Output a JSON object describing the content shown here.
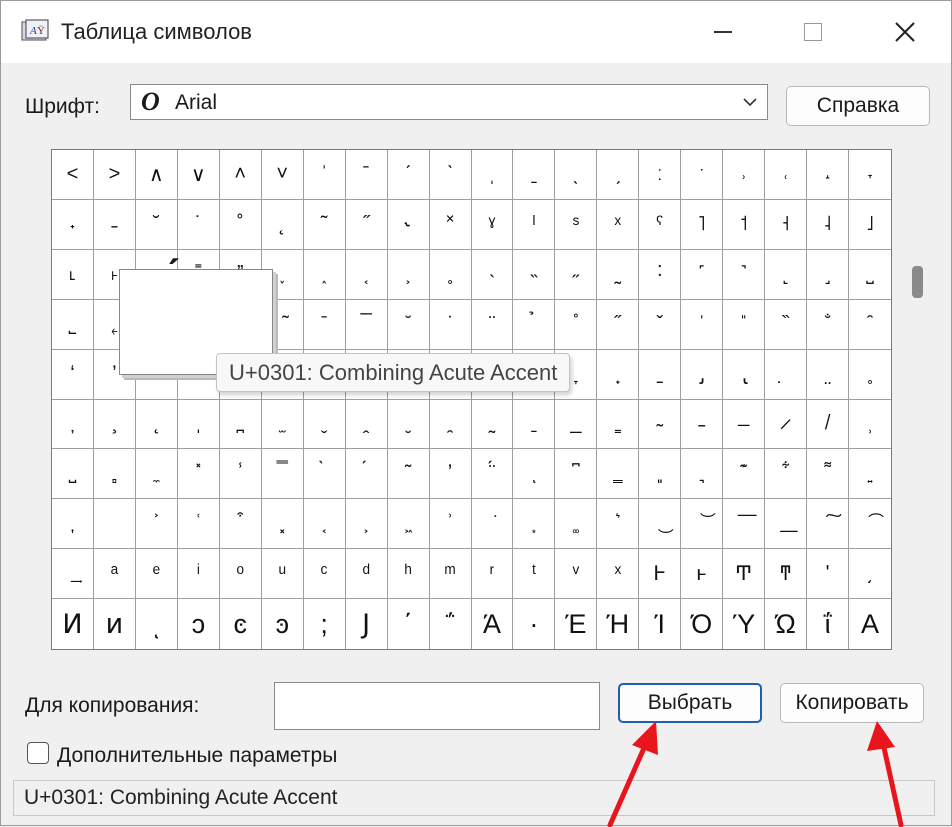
{
  "window": {
    "title": "Таблица символов",
    "controls": {
      "minimize": "minimize",
      "maximize": "maximize",
      "close": "close"
    }
  },
  "font_row": {
    "label": "Шрифт:",
    "logo": "O",
    "selected_font": "Arial",
    "help_button": "Справка"
  },
  "grid": {
    "rows": [
      [
        "<",
        ">",
        "∧",
        "∨",
        "˄",
        "˅",
        "ˈ",
        "ˉ",
        "ˊ",
        "ˋ",
        "ˌ",
        "ˍ",
        "ˎ",
        "ˏ",
        "ː",
        "ˑ",
        "˒",
        "˓",
        "˔",
        "˕"
      ],
      [
        "˖",
        "˗",
        "˘",
        "˙",
        "˚",
        "˛",
        "˜",
        "˝",
        "˞",
        "˟",
        "ˠ",
        "ˡ",
        "ˢ",
        "ˣ",
        "ˤ",
        "˥",
        "˦",
        "˧",
        "˨",
        "˩"
      ],
      [
        "˪",
        "˫",
        "ˬ",
        "˭",
        "ˮ",
        "˯",
        "˰",
        "˱",
        "˲",
        "˳",
        "˴",
        "˵",
        "˶",
        "˷",
        "˸",
        "˹",
        "˺",
        "˻",
        "˼",
        "˽"
      ],
      [
        "˾",
        "˿",
        "̀",
        "́",
        "̂",
        "̃",
        "̄",
        "̅",
        "̆",
        "̇",
        "̈",
        "̉",
        "̊",
        "̋",
        "̌",
        "̍",
        "̎",
        "̏",
        "̐",
        "̑"
      ],
      [
        "̒",
        "̓",
        "̔",
        "̕",
        "̖",
        "̗",
        "̘",
        "̙",
        "̚",
        "̛",
        "̜",
        "̝",
        "̞",
        "̟",
        "̠",
        "̡",
        "̢",
        "̣",
        "̤",
        "̥"
      ],
      [
        "̦",
        "̧",
        "̨",
        "̩",
        "̪",
        "̫",
        "̬",
        "̭",
        "̮",
        "̯",
        "̰",
        "̱",
        "̲",
        "̳",
        "̴",
        "̵",
        "̶",
        "̷",
        "̸",
        "̹"
      ],
      [
        "̺",
        "̻",
        "̼",
        "̽",
        "̾",
        "̿",
        "̀",
        "́",
        "͂",
        "̓",
        "̈́",
        "ͅ",
        "͆",
        "͇",
        "͈",
        "͉",
        "͊",
        "͋",
        "͌",
        "͍"
      ],
      [
        "͎",
        "͏",
        "͐",
        "͑",
        "͒",
        "͓",
        "͔",
        "͕",
        "͖",
        "͗",
        "͘",
        "͙",
        "͚",
        "͛",
        "͜",
        "͝",
        "͞",
        "͟",
        "͠",
        "͡"
      ],
      [
        "͢",
        "ͣ",
        "ͤ",
        "ͥ",
        "ͦ",
        "ͧ",
        "ͨ",
        "ͩ",
        "ͪ",
        "ͫ",
        "ͬ",
        "ͭ",
        "ͮ",
        "ͯ",
        "Ͱ",
        "ͱ",
        "Ͳ",
        "ͳ",
        "ʹ",
        "͵"
      ],
      [
        "Ͷ",
        "ͷ",
        "ͺ",
        "ͻ",
        "ͼ",
        "ͽ",
        ";",
        "Ϳ",
        "΄",
        "΅",
        "Ά",
        "·",
        "Έ",
        "Ή",
        "Ί",
        "Ό",
        "Ύ",
        "Ώ",
        "ΐ",
        "Α"
      ]
    ]
  },
  "magnifier": {
    "glyph": "́"
  },
  "tooltip": {
    "text": "U+0301: Combining Acute Accent"
  },
  "copy_row": {
    "label": "Для копирования:",
    "value": "",
    "select_button": "Выбрать",
    "copy_button": "Копировать"
  },
  "advanced": {
    "label": "Дополнительные параметры",
    "checked": false
  },
  "status": {
    "text": "U+0301: Combining Acute Accent"
  },
  "colors": {
    "arrow": "#e8161c",
    "focus_border": "#1d5fb0"
  }
}
